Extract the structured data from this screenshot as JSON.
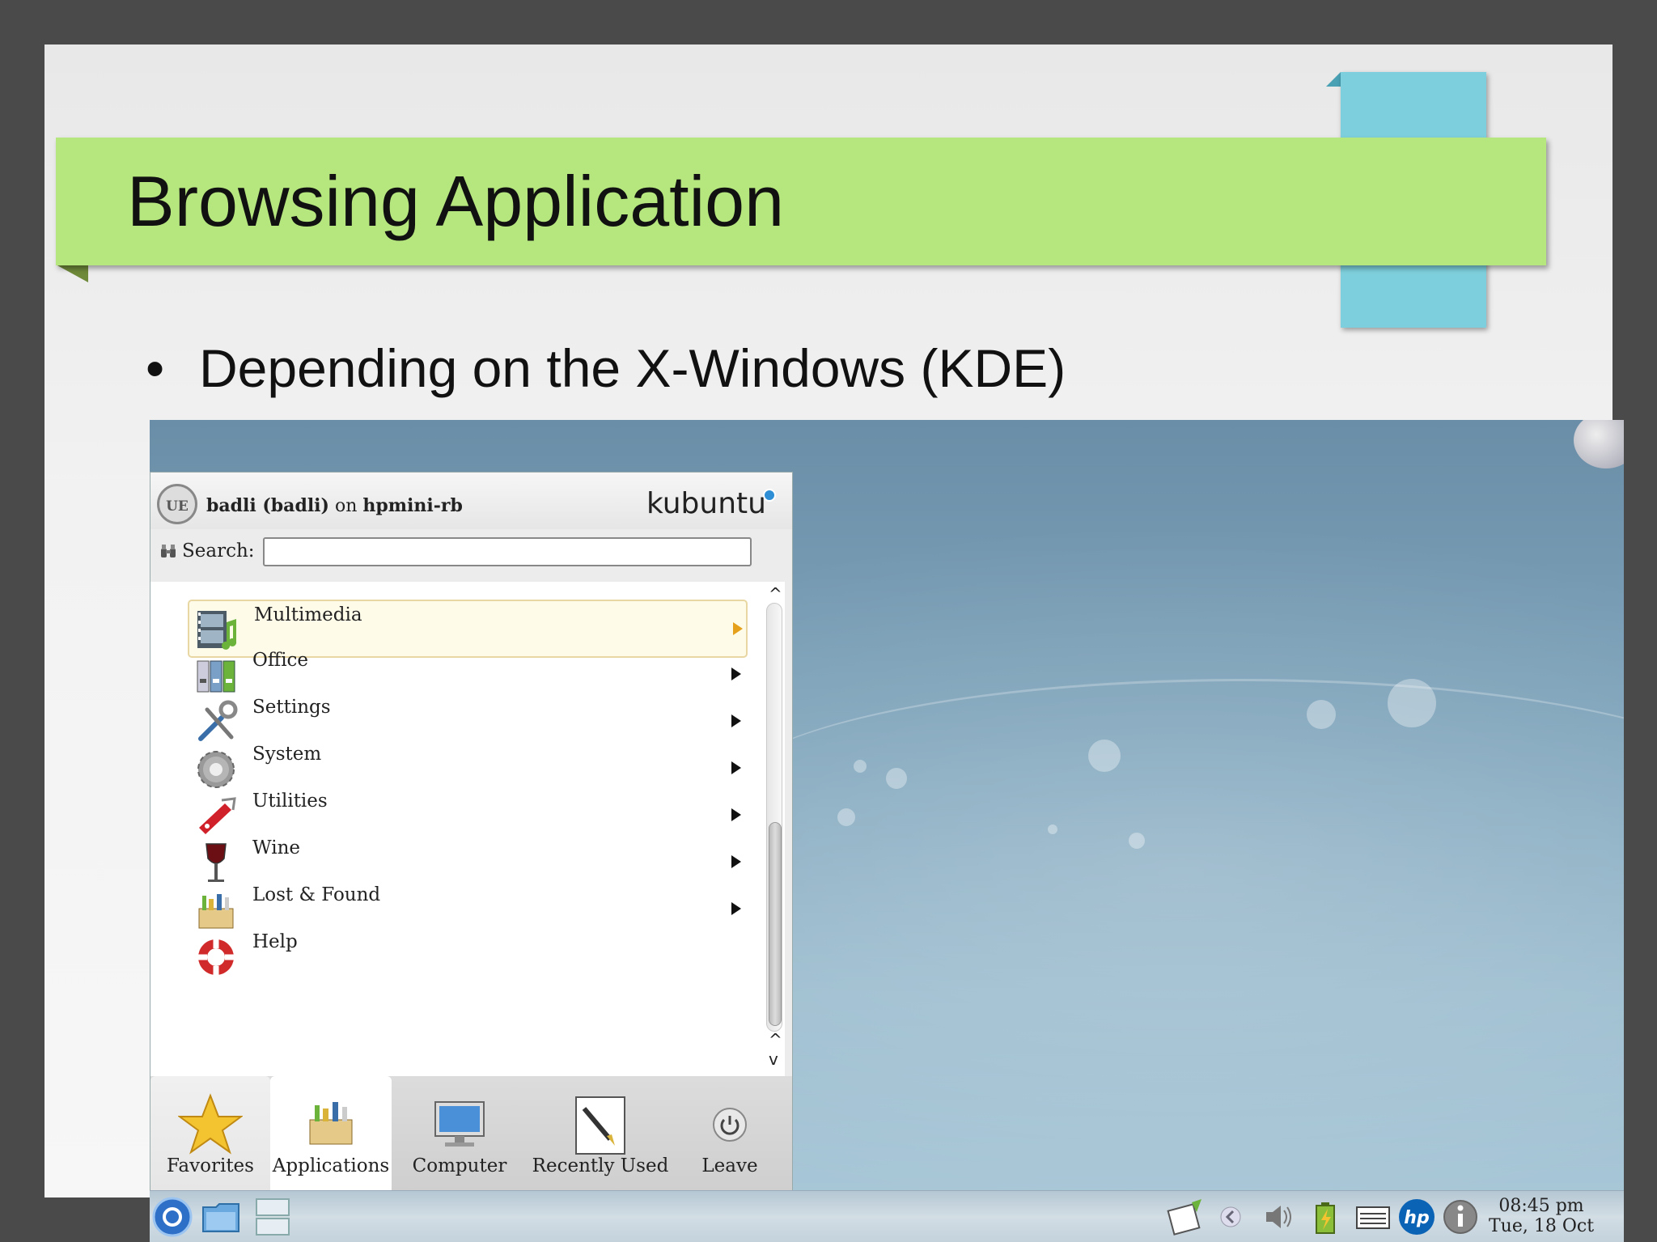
{
  "slide": {
    "title": "Browsing Application",
    "bullet": "Depending on the X-Windows (KDE)"
  },
  "kickoff": {
    "avatar_text": "UE",
    "user_name": "badli (badli)",
    "user_on": "on",
    "host_name": "hpmini-rb",
    "distro_logo": "kubuntu",
    "search_label": "Search:",
    "search_value": "",
    "categories": [
      {
        "label": "Multimedia",
        "icon": "multimedia-icon",
        "selected": true
      },
      {
        "label": "Office",
        "icon": "office-icon"
      },
      {
        "label": "Settings",
        "icon": "settings-icon"
      },
      {
        "label": "System",
        "icon": "system-icon"
      },
      {
        "label": "Utilities",
        "icon": "utilities-icon"
      },
      {
        "label": "Wine",
        "icon": "wine-icon"
      },
      {
        "label": "Lost & Found",
        "icon": "lost-found-icon"
      },
      {
        "label": "Help",
        "icon": "help-icon",
        "has_submenu": false
      }
    ],
    "tabs": [
      {
        "label": "Favorites",
        "icon": "star-icon"
      },
      {
        "label": "Applications",
        "icon": "applications-icon",
        "active": true
      },
      {
        "label": "Computer",
        "icon": "computer-icon"
      },
      {
        "label": "Recently Used",
        "icon": "recently-used-icon"
      },
      {
        "label": "Leave",
        "icon": "power-icon"
      }
    ]
  },
  "taskbar": {
    "clock_time": "08:45 pm",
    "clock_date": "Tue, 18 Oct",
    "tray_icons": [
      "klipper-icon",
      "volume-icon",
      "battery-icon",
      "keyboard-icon",
      "hp-icon",
      "info-icon"
    ]
  },
  "colors": {
    "title_bar": "#b6e67e",
    "accent_tab": "#7ecfdd",
    "desktop": "#7ea3ba",
    "selected_arrow": "#e5a11b"
  }
}
